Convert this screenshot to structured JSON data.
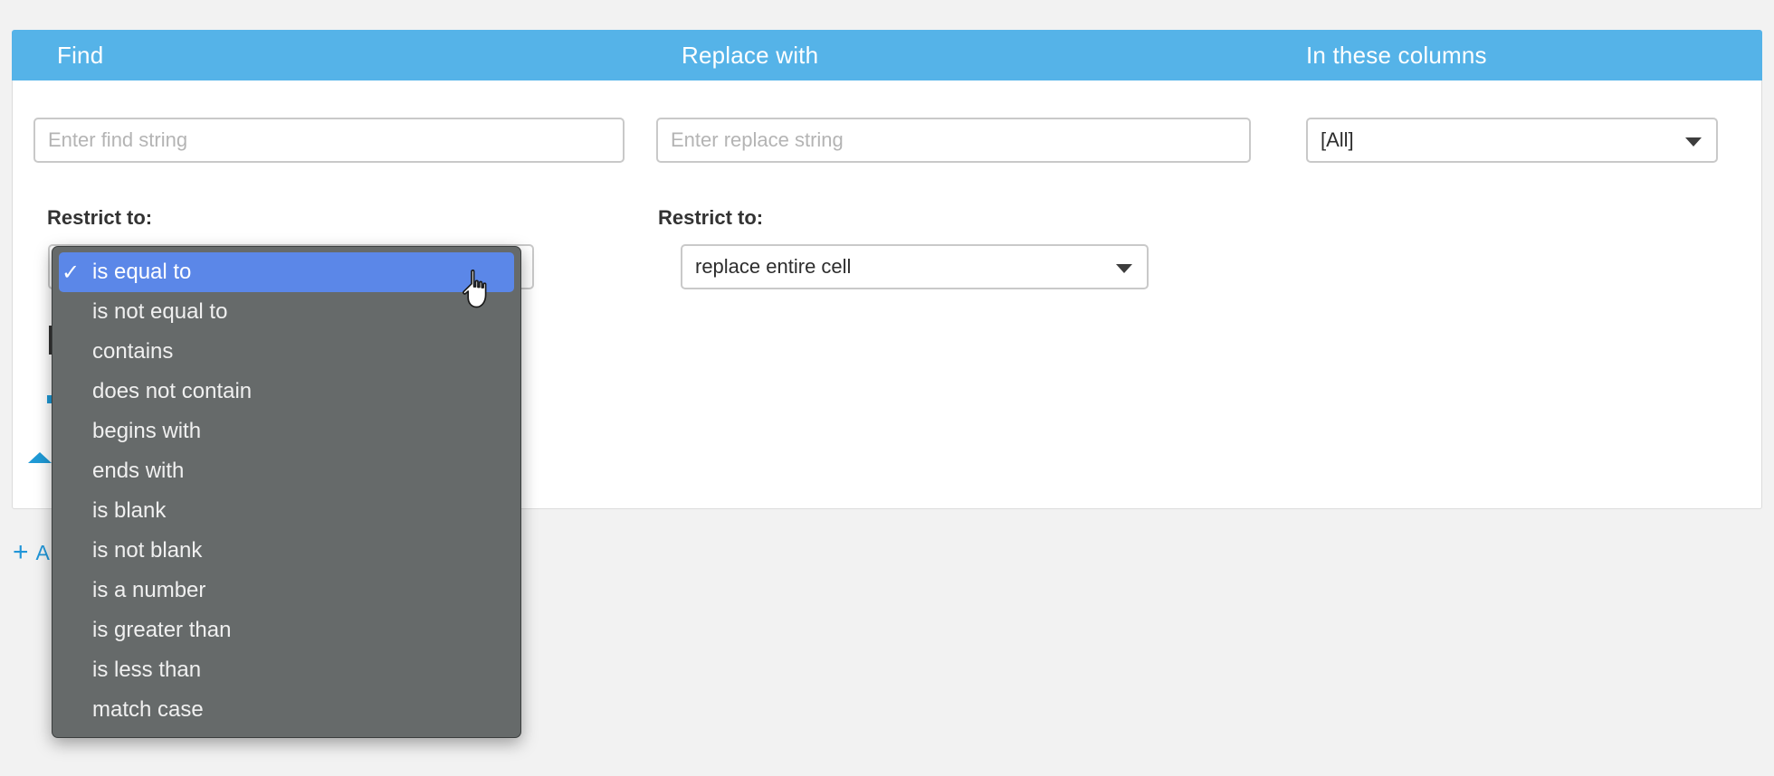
{
  "header": {
    "columns": [
      {
        "label": "Find"
      },
      {
        "label": "Replace with"
      },
      {
        "label": "In these columns"
      }
    ],
    "background_color": "#55b3e8"
  },
  "find_section": {
    "input_placeholder": "Enter find string",
    "input_value": "",
    "restrict_label": "Restrict to:",
    "restrict_value": "is equal to"
  },
  "replace_section": {
    "input_placeholder": "Enter replace string",
    "input_value": "",
    "restrict_label": "Restrict to:",
    "restrict_value": "replace entire cell"
  },
  "columns_section": {
    "selected": "[All]"
  },
  "add_link": {
    "plus": "+",
    "label": "A"
  },
  "dropdown": {
    "open": true,
    "selected_index": 0,
    "check_glyph": "✓",
    "highlight_color": "#5b87e8",
    "background_color": "#666a6a",
    "items": [
      {
        "label": "is equal to"
      },
      {
        "label": "is not equal to"
      },
      {
        "label": "contains"
      },
      {
        "label": "does not contain"
      },
      {
        "label": "begins with"
      },
      {
        "label": "ends with"
      },
      {
        "label": "is blank"
      },
      {
        "label": "is not blank"
      },
      {
        "label": "is a number"
      },
      {
        "label": "is greater than"
      },
      {
        "label": "is less than"
      },
      {
        "label": "match case"
      }
    ]
  },
  "cursor": {
    "type": "pointing-hand"
  }
}
